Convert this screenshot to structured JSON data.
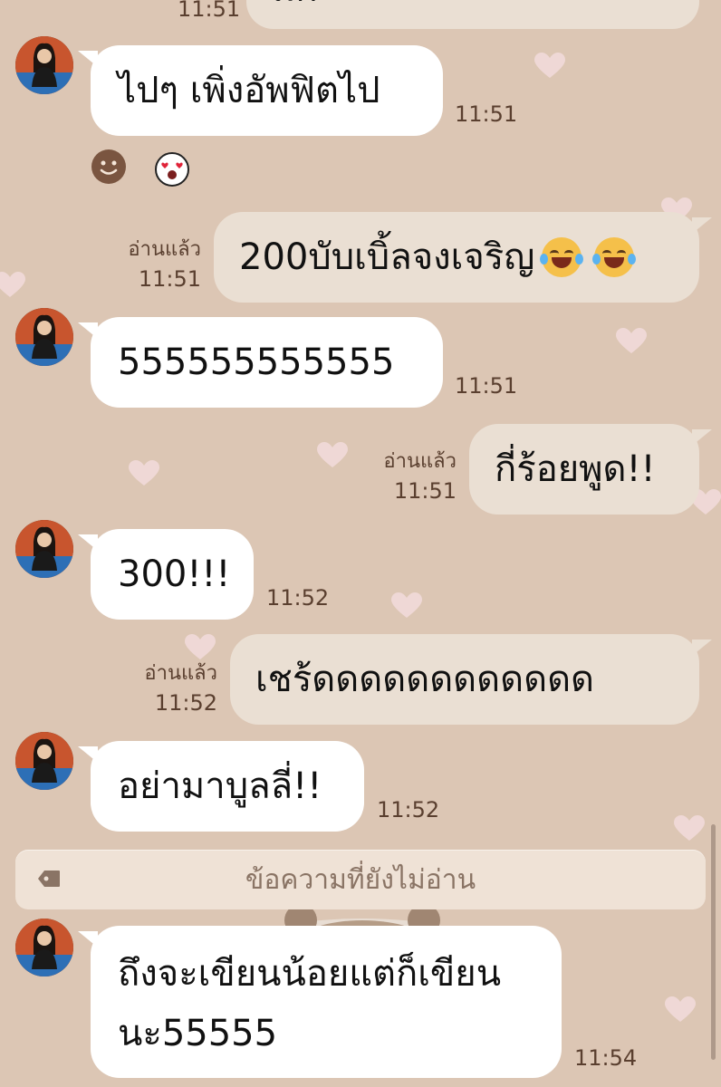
{
  "previous_message": {
    "text_partial": "มีก",
    "time": "11:51"
  },
  "messages": [
    {
      "direction": "incoming",
      "text": "ไปๆ เพิ่งอัพฟิตไป",
      "time": "11:51",
      "reactions": [
        "smile-reaction-icon",
        "heart-eyes-reaction-icon"
      ]
    },
    {
      "direction": "outgoing",
      "text": "200บับเบิ้ลจงเจริญ",
      "read": "อ่านแล้ว",
      "time": "11:51",
      "emojis": [
        "laughing-tears-emoji-icon",
        "laughing-tears-emoji-icon"
      ]
    },
    {
      "direction": "incoming",
      "text": "555555555555",
      "time": "11:51"
    },
    {
      "direction": "outgoing",
      "text": "กี่ร้อยพูด!!",
      "read": "อ่านแล้ว",
      "time": "11:51"
    },
    {
      "direction": "incoming",
      "text": "300!!!",
      "time": "11:52"
    },
    {
      "direction": "outgoing",
      "text": "เชร้ดดดดดดดดดดดด",
      "read": "อ่านแล้ว",
      "time": "11:52"
    },
    {
      "direction": "incoming",
      "text": "อย่ามาบูลลี่!!",
      "time": "11:52"
    },
    {
      "direction": "incoming",
      "text_line1": "ถึงจะเขียนน้อยแต่ก็เขียน",
      "text_line2": "นะ55555",
      "time": "11:54"
    }
  ],
  "unread_divider": {
    "label": "ข้อความที่ยังไม่อ่าน",
    "icon": "tag-icon"
  },
  "colors": {
    "background": "#dcc6b4",
    "incoming_bubble": "#ffffff",
    "outgoing_bubble": "#eadfd3",
    "meta_text": "#5a3f2f",
    "heart": "#f3dcdc"
  }
}
